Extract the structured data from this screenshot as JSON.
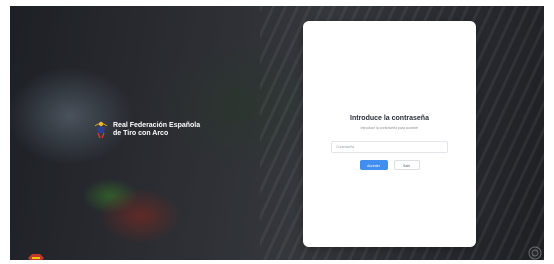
{
  "organization": {
    "name": "Real Federación Española\nde Tiro con Arco",
    "logo_icon": "archer-logo-icon"
  },
  "login_card": {
    "title": "Introduce la contraseña",
    "subtitle": "Introduce la contraseña para acceder",
    "password_placeholder": "Contraseña",
    "submit_label": "Acceder",
    "cancel_label": "Salir"
  },
  "colors": {
    "primary": "#3f8ef0",
    "card_background": "#ffffff",
    "title_text": "#2b2f3a"
  }
}
